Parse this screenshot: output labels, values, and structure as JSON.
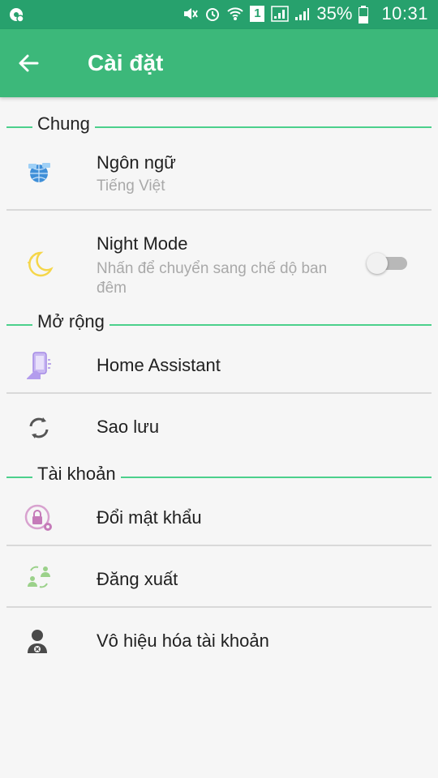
{
  "status_bar": {
    "battery": "35%",
    "time": "10:31",
    "sim": "1"
  },
  "app_bar": {
    "title": "Cài đặt"
  },
  "sections": [
    {
      "label": "Chung"
    },
    {
      "label": "Mở rộng"
    },
    {
      "label": "Tài khoản"
    }
  ],
  "items": {
    "language": {
      "title": "Ngôn ngữ",
      "subtitle": "Tiếng Việt",
      "icon": "globe-icon"
    },
    "night_mode": {
      "title": "Night Mode",
      "subtitle": "Nhấn để chuyển sang chế dộ ban đêm",
      "icon": "moon-icon",
      "enabled": false
    },
    "home_assistant": {
      "title": "Home Assistant",
      "icon": "phone-hand-icon"
    },
    "backup": {
      "title": "Sao lưu",
      "icon": "sync-icon"
    },
    "change_password": {
      "title": "Đổi mật khẩu",
      "icon": "lock-gear-icon"
    },
    "logout": {
      "title": "Đăng xuất",
      "icon": "switch-user-icon"
    },
    "deactivate": {
      "title": "Vô hiệu hóa tài khoản",
      "icon": "user-block-icon"
    }
  },
  "colors": {
    "status_bar": "#27a16d",
    "app_bar": "#3cb87a",
    "section_line": "#4cd08c",
    "background": "#f6f6f6"
  }
}
